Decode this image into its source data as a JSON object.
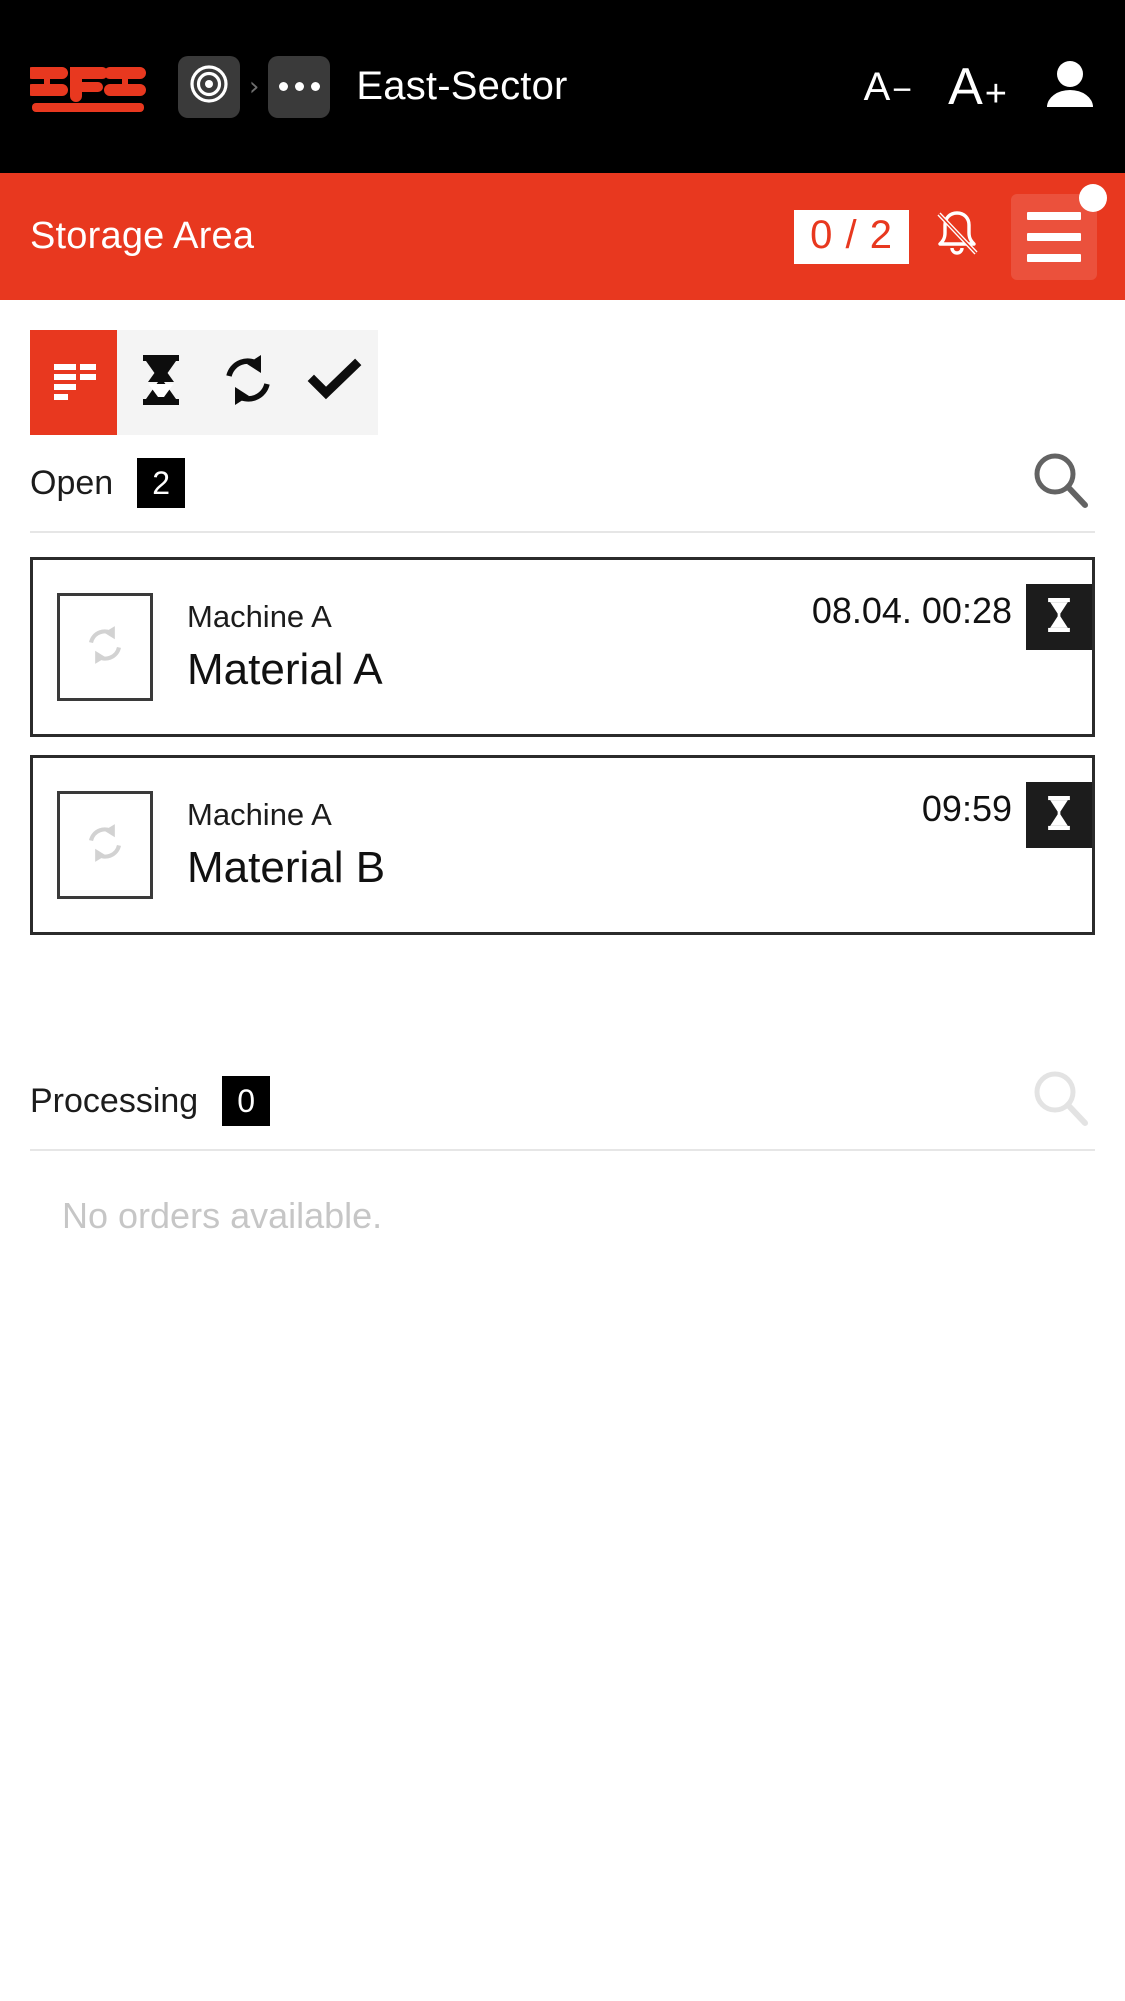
{
  "topbar": {
    "logo_text": "SFS",
    "logo_color": "#e8381f",
    "breadcrumb": {
      "home_icon": "target-icon",
      "separator": "›",
      "overflow_icon": "ellipsis-icon",
      "title": "East-Sector"
    },
    "actions": {
      "font_decrease_letter": "A",
      "font_decrease_sign": "−",
      "font_increase_letter": "A",
      "font_increase_sign": "+",
      "account_icon": "person-icon"
    }
  },
  "header": {
    "title": "Storage Area",
    "counter": "0 / 2",
    "notification_icon": "bell-off-icon",
    "menu_icon": "hamburger-menu-icon",
    "has_menu_badge": true,
    "background_color": "#e8381f"
  },
  "tabs": [
    {
      "id": "overview",
      "icon": "list-report-icon",
      "active": true
    },
    {
      "id": "pending",
      "icon": "hourglass-icon",
      "active": false
    },
    {
      "id": "progress",
      "icon": "sync-refresh-icon",
      "active": false
    },
    {
      "id": "done",
      "icon": "check-icon",
      "active": false
    }
  ],
  "sections": [
    {
      "id": "open",
      "label": "Open",
      "count": "2",
      "search_icon": "search-icon",
      "search_enabled": true,
      "empty_message": null
    },
    {
      "id": "processing",
      "label": "Processing",
      "count": "0",
      "search_icon": "search-icon",
      "search_enabled": false,
      "empty_message": "No orders available."
    }
  ],
  "orders": [
    {
      "thumb_icon": "sync-refresh-icon",
      "machine": "Machine A",
      "material": "Material A",
      "time": "08.04. 00:28",
      "status_icon": "hourglass-icon"
    },
    {
      "thumb_icon": "sync-refresh-icon",
      "machine": "Machine A",
      "material": "Material B",
      "time": "09:59",
      "status_icon": "hourglass-icon"
    }
  ]
}
